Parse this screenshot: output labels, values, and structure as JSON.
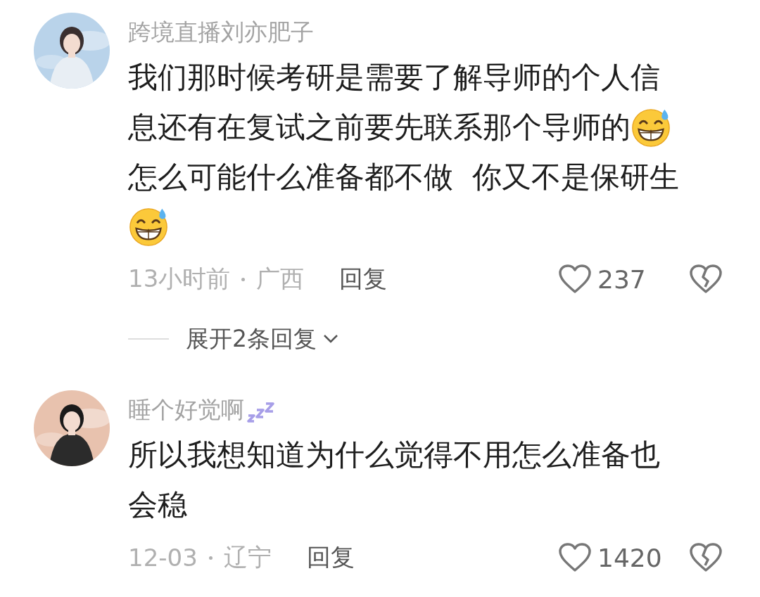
{
  "comments": [
    {
      "username": "跨境直播刘亦肥子",
      "body": [
        {
          "kind": "text",
          "text": "我们那时候考研是需要了解导师的个人信"
        },
        {
          "kind": "text",
          "text": "息还有在复试之前要先联系那个导师的"
        },
        {
          "kind": "emoji"
        },
        {
          "kind": "text",
          "text": "怎么可能什么准备都不做  你又不是保研生"
        },
        {
          "kind": "emoji"
        }
      ],
      "time": "13小时前",
      "location": "广西",
      "reply": "回复",
      "likes": "237",
      "expand": "展开2条回复"
    },
    {
      "username": "睡个好觉啊",
      "badge": {
        "kind": "zzz"
      },
      "body": [
        {
          "kind": "text",
          "text": "所以我想知道为什么觉得不用怎么准备也"
        },
        {
          "kind": "text",
          "text": "会稳"
        }
      ],
      "time": "12-03",
      "location": "辽宁",
      "reply": "回复",
      "likes": "1420"
    }
  ]
}
